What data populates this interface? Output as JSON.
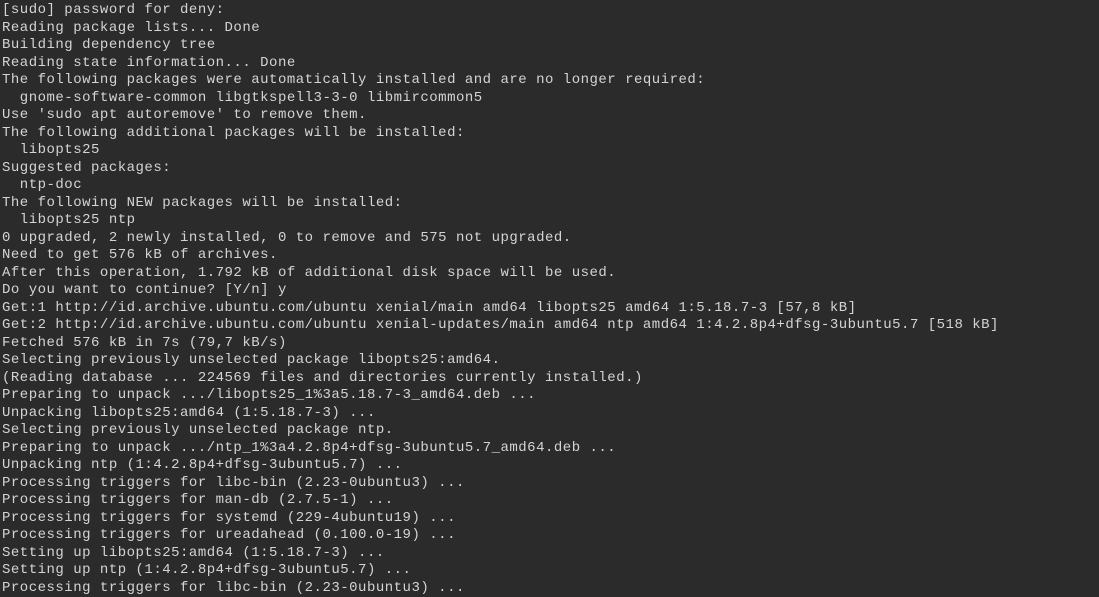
{
  "terminal": {
    "lines": [
      "[sudo] password for deny:",
      "Reading package lists... Done",
      "Building dependency tree",
      "Reading state information... Done",
      "The following packages were automatically installed and are no longer required:",
      "  gnome-software-common libgtkspell3-3-0 libmircommon5",
      "Use 'sudo apt autoremove' to remove them.",
      "The following additional packages will be installed:",
      "  libopts25",
      "Suggested packages:",
      "  ntp-doc",
      "The following NEW packages will be installed:",
      "  libopts25 ntp",
      "0 upgraded, 2 newly installed, 0 to remove and 575 not upgraded.",
      "Need to get 576 kB of archives.",
      "After this operation, 1.792 kB of additional disk space will be used.",
      "Do you want to continue? [Y/n] y",
      "Get:1 http://id.archive.ubuntu.com/ubuntu xenial/main amd64 libopts25 amd64 1:5.18.7-3 [57,8 kB]",
      "Get:2 http://id.archive.ubuntu.com/ubuntu xenial-updates/main amd64 ntp amd64 1:4.2.8p4+dfsg-3ubuntu5.7 [518 kB]",
      "Fetched 576 kB in 7s (79,7 kB/s)",
      "Selecting previously unselected package libopts25:amd64.",
      "(Reading database ... 224569 files and directories currently installed.)",
      "Preparing to unpack .../libopts25_1%3a5.18.7-3_amd64.deb ...",
      "Unpacking libopts25:amd64 (1:5.18.7-3) ...",
      "Selecting previously unselected package ntp.",
      "Preparing to unpack .../ntp_1%3a4.2.8p4+dfsg-3ubuntu5.7_amd64.deb ...",
      "Unpacking ntp (1:4.2.8p4+dfsg-3ubuntu5.7) ...",
      "Processing triggers for libc-bin (2.23-0ubuntu3) ...",
      "Processing triggers for man-db (2.7.5-1) ...",
      "Processing triggers for systemd (229-4ubuntu19) ...",
      "Processing triggers for ureadahead (0.100.0-19) ...",
      "Setting up libopts25:amd64 (1:5.18.7-3) ...",
      "Setting up ntp (1:4.2.8p4+dfsg-3ubuntu5.7) ...",
      "Processing triggers for libc-bin (2.23-0ubuntu3) ..."
    ]
  }
}
